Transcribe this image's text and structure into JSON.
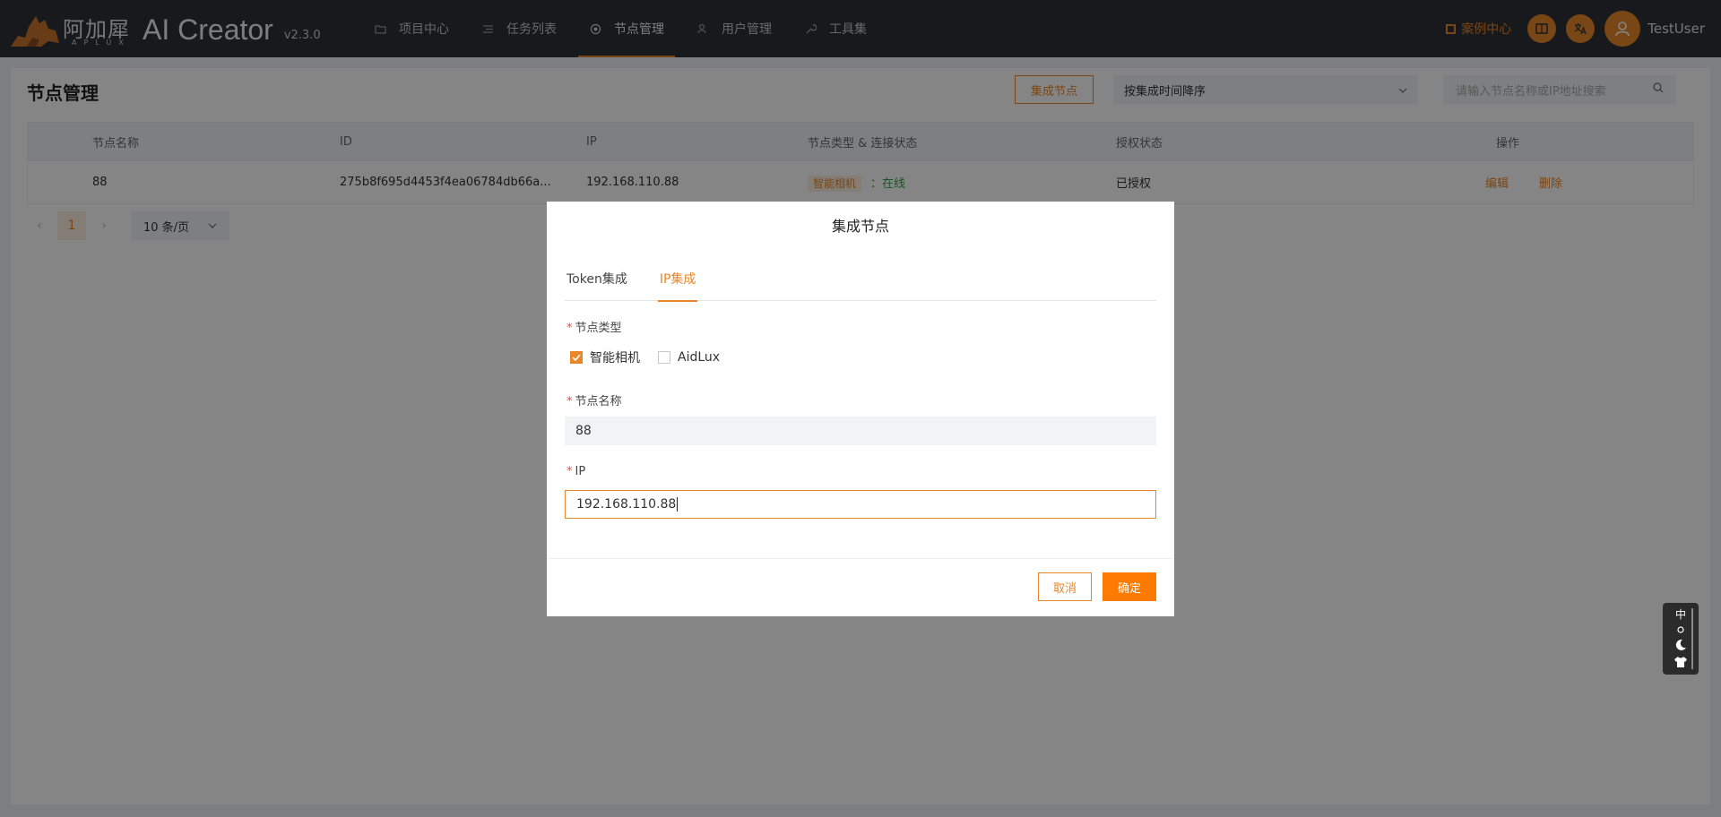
{
  "header": {
    "logo_cn": "阿加犀",
    "logo_en": "APLUX",
    "title": "AI Creator",
    "version": "v2.3.0",
    "nav": [
      {
        "label": "项目中心",
        "icon": "folder-icon"
      },
      {
        "label": "任务列表",
        "icon": "list-icon"
      },
      {
        "label": "节点管理",
        "icon": "node-icon",
        "active": true
      },
      {
        "label": "用户管理",
        "icon": "user-group-icon"
      },
      {
        "label": "工具集",
        "icon": "wrench-icon"
      }
    ],
    "case_center": "案例中心",
    "username": "TestUser",
    "accent": "#e9862a"
  },
  "page": {
    "title": "节点管理",
    "integrate_button": "集成节点",
    "sort_select": "按集成时间降序",
    "search_placeholder": "请输入节点名称或IP地址搜索"
  },
  "table": {
    "columns": [
      "节点名称",
      "ID",
      "IP",
      "节点类型 & 连接状态",
      "授权状态",
      "操作"
    ],
    "rows": [
      {
        "name": "88",
        "id": "275b8f695d4453f4ea06784db66a...",
        "ip": "192.168.110.88",
        "type_tag": "智能相机",
        "status": "：在线",
        "auth": "已授权",
        "edit": "编辑",
        "delete": "删除"
      }
    ]
  },
  "pager": {
    "current": "1",
    "page_size": "10 条/页"
  },
  "modal": {
    "title": "集成节点",
    "tabs": [
      "Token集成",
      "IP集成"
    ],
    "active_tab": 1,
    "type_label": "节点类型",
    "type_options": [
      {
        "label": "智能相机",
        "checked": true
      },
      {
        "label": "AidLux",
        "checked": false
      }
    ],
    "name_label": "节点名称",
    "name_value": "88",
    "ip_label": "IP",
    "ip_value": "192.168.110.88",
    "cancel": "取消",
    "confirm": "确定"
  },
  "float_tool": {
    "lang": "中",
    "icons": [
      "settings-icon",
      "moon-icon",
      "shirt-icon"
    ]
  }
}
